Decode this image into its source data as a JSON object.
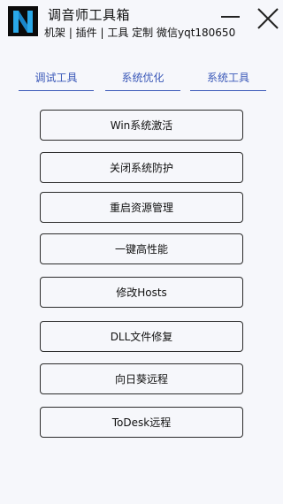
{
  "window": {
    "title": "调音师工具箱",
    "subtitle": "机架 | 插件 | 工具 定制 微信yqt180650",
    "logo_letter": "N",
    "controls": {
      "minimize": "minimize-icon",
      "close": "close-icon"
    }
  },
  "tabs": [
    {
      "label": "调试工具"
    },
    {
      "label": "系统优化"
    },
    {
      "label": "系统工具",
      "active": true
    }
  ],
  "actions": [
    {
      "label": "Win系统激活"
    },
    {
      "label": "关闭系统防护"
    },
    {
      "label": "重启资源管理"
    },
    {
      "label": "一键高性能"
    },
    {
      "label": "修改Hosts"
    },
    {
      "label": "DLL文件修复"
    },
    {
      "label": "向日葵远程"
    },
    {
      "label": "ToDesk远程"
    }
  ],
  "colors": {
    "background": "#f6f7fb",
    "tab_accent": "#3a58b8",
    "logo_bg": "#0b0b0b",
    "logo_letter": "#2aa8e8"
  }
}
